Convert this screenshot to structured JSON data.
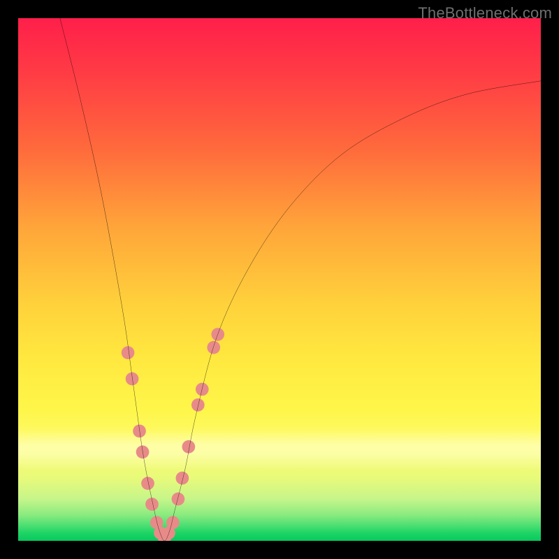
{
  "attribution": {
    "text": "TheBottleneck.com"
  },
  "chart_data": {
    "type": "line",
    "title": "",
    "xlabel": "",
    "ylabel": "",
    "xlim": [
      0,
      100
    ],
    "ylim": [
      0,
      100
    ],
    "grid": false,
    "legend": false,
    "note": "Axes are unlabeled in the source image; values are read as percent of plot width/height from the pixel positions of the visible curve. Lower y (closer to the green band) is better.",
    "background_gradient_stops": [
      {
        "pos": 0,
        "color": "#ff1f4a"
      },
      {
        "pos": 25,
        "color": "#ff6a3c"
      },
      {
        "pos": 55,
        "color": "#ffd23b"
      },
      {
        "pos": 82,
        "color": "#fdfc70"
      },
      {
        "pos": 95,
        "color": "#8beb7f"
      },
      {
        "pos": 100,
        "color": "#07c95c"
      }
    ],
    "series": [
      {
        "name": "bottleneck-curve",
        "color": "#000000",
        "x": [
          8,
          12,
          16,
          20,
          22,
          24,
          26,
          27,
          28,
          29,
          30,
          32,
          34,
          38,
          44,
          52,
          62,
          74,
          86,
          100
        ],
        "y": [
          100,
          84,
          66,
          44,
          30,
          16,
          6,
          2,
          0,
          2,
          6,
          14,
          24,
          39,
          52,
          64,
          74,
          81,
          85.5,
          88
        ]
      }
    ],
    "markers": {
      "name": "sample-dots",
      "color": "#e88b88",
      "radius_pct": 1.25,
      "points": [
        {
          "x": 21.0,
          "y": 36.0
        },
        {
          "x": 21.8,
          "y": 31.0
        },
        {
          "x": 23.2,
          "y": 21.0
        },
        {
          "x": 23.8,
          "y": 17.0
        },
        {
          "x": 24.8,
          "y": 11.0
        },
        {
          "x": 25.6,
          "y": 7.0
        },
        {
          "x": 26.5,
          "y": 3.5
        },
        {
          "x": 27.2,
          "y": 1.5
        },
        {
          "x": 28.0,
          "y": 0.5
        },
        {
          "x": 28.8,
          "y": 1.5
        },
        {
          "x": 29.6,
          "y": 3.5
        },
        {
          "x": 30.6,
          "y": 8.0
        },
        {
          "x": 31.4,
          "y": 12.0
        },
        {
          "x": 32.6,
          "y": 18.0
        },
        {
          "x": 34.4,
          "y": 26.0
        },
        {
          "x": 35.2,
          "y": 29.0
        },
        {
          "x": 37.4,
          "y": 37.0
        },
        {
          "x": 38.2,
          "y": 39.5
        }
      ]
    }
  }
}
